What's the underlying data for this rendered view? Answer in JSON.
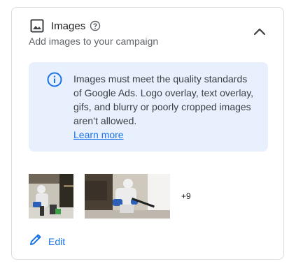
{
  "section": {
    "title": "Images",
    "subtitle": "Add images to your campaign"
  },
  "notice": {
    "text": "Images must meet the quality standards of Google Ads. Logo overlay, text overlay, gifs, and blurry or poorly cropped images aren’t allowed.",
    "link": "Learn more"
  },
  "thumbnails": {
    "more_count": "+9"
  },
  "actions": {
    "edit_label": "Edit"
  },
  "icons": {
    "header": "image-icon",
    "help": "help-circle-icon",
    "collapse": "chevron-up-icon",
    "info": "info-icon",
    "edit": "pencil-icon"
  },
  "colors": {
    "accent": "#1a73e8",
    "notice_bg": "#e8f0fe",
    "border": "#dadce0"
  }
}
